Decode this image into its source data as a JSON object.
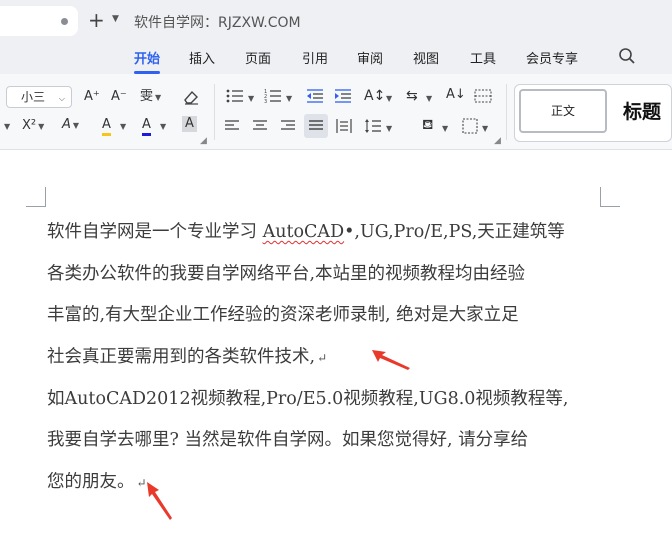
{
  "titlebar": {
    "new_tab_icon": "plus-icon",
    "site_title": "软件自学网：RJZXW.COM"
  },
  "menu": {
    "items": [
      "开始",
      "插入",
      "页面",
      "引用",
      "审阅",
      "视图",
      "工具",
      "会员专享"
    ],
    "active_index": 0,
    "accent_color": "#2f62f0"
  },
  "toolbar": {
    "font_size": "小三",
    "grow_font_label": "A⁺",
    "shrink_font_label": "A⁻",
    "pinyin_label": "雯",
    "superscript_label": "X²",
    "text_effect_label": "A",
    "highlight_label": "A",
    "font_color_label": "A",
    "char_shading_label": "A",
    "highlight_color": "#f5c518",
    "font_color": "#1a1adb",
    "styles": {
      "normal": "正文",
      "heading1": "标题"
    }
  },
  "document": {
    "paragraph1": {
      "line1_before": "软件自学网是一个专业学习 ",
      "line1_misspelled": "AutoCAD",
      "line1_after": "•,UG,Pro/E,PS,天正建筑等",
      "line2": "各类办公软件的我要自学网络平台,本站里的视频教程均由经验",
      "line3": "丰富的,有大型企业工作经验的资深老师录制, 绝对是大家立足",
      "line4": "社会真正要需用到的各类软件技术,"
    },
    "paragraph2": {
      "line1": "如AutoCAD2012视频教程,Pro/E5.0视频教程,UG8.0视频教程等,",
      "line2": "我要自学去哪里? 当然是软件自学网。如果您觉得好, 请分享给",
      "line3": "您的朋友。"
    },
    "paragraph_mark": "↵",
    "annotation_color": "#e8392b"
  }
}
